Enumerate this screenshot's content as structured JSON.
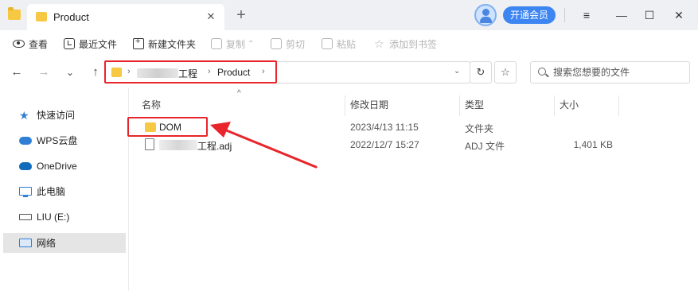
{
  "titlebar": {
    "tab_title": "Product",
    "tab_close": "✕",
    "new_tab": "+",
    "vip_label": "开通会员",
    "menu_icon": "≡",
    "minimize": "—",
    "maximize": "☐",
    "close": "✕"
  },
  "toolbar": {
    "view": "查看",
    "recent": "最近文件",
    "new_folder": "新建文件夹",
    "copy": "复制",
    "copy_caret": "⌃",
    "cut": "剪切",
    "paste": "粘贴",
    "bookmark": "添加到书签"
  },
  "nav": {
    "back": "←",
    "forward": "→",
    "history": "⌄",
    "up": "↑"
  },
  "address": {
    "sep1": "›",
    "segment_2": "工程",
    "sep2": "›",
    "segment_3": "Product",
    "sep3": "›",
    "dropdown": "⌄",
    "refresh": "↻",
    "bookmark": "☆"
  },
  "search": {
    "placeholder": "搜索您想要的文件"
  },
  "sidebar": {
    "items": [
      {
        "label": "快速访问",
        "icon": "star-icon"
      },
      {
        "label": "WPS云盘",
        "icon": "cloud-icon"
      },
      {
        "label": "OneDrive",
        "icon": "onedrive-icon"
      },
      {
        "label": "此电脑",
        "icon": "computer-icon"
      },
      {
        "label": "LIU (E:)",
        "icon": "drive-icon"
      },
      {
        "label": "网络",
        "icon": "network-icon"
      }
    ],
    "selected": "网络"
  },
  "columns": {
    "name": "名称",
    "sort_caret": "^",
    "modified": "修改日期",
    "type": "类型",
    "size": "大小"
  },
  "files": [
    {
      "name": "DOM",
      "modified": "2023/4/13 11:15",
      "type": "文件夹",
      "size": "",
      "icon": "folder-icon"
    },
    {
      "name": "工程.adj",
      "modified": "2022/12/7 15:27",
      "type": "ADJ 文件",
      "size": "1,401 KB",
      "icon": "file-icon"
    }
  ],
  "annotation_color": "#e8252a",
  "accent_color": "#3d86f2"
}
